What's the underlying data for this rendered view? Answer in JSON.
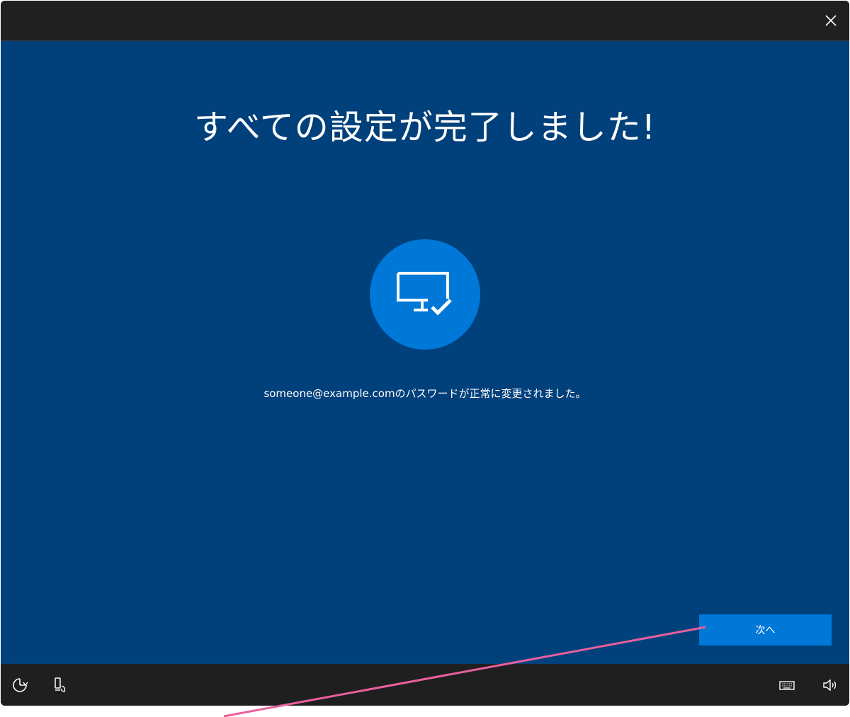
{
  "window": {
    "close_icon": "close-icon"
  },
  "main": {
    "heading": "すべての設定が完了しました!",
    "hero_icon": "monitor-check-icon",
    "message": "someone@example.comのパスワードが正常に変更されました。",
    "next_label": "次へ"
  },
  "taskbar": {
    "left_icons": [
      "accessibility-icon",
      "narrator-icon"
    ],
    "right_icons": [
      "keyboard-icon",
      "volume-icon"
    ]
  },
  "colors": {
    "content_bg": "#00407b",
    "accent": "#0078d7",
    "titlebar_bg": "#202020",
    "annotation": "#e8609c"
  }
}
